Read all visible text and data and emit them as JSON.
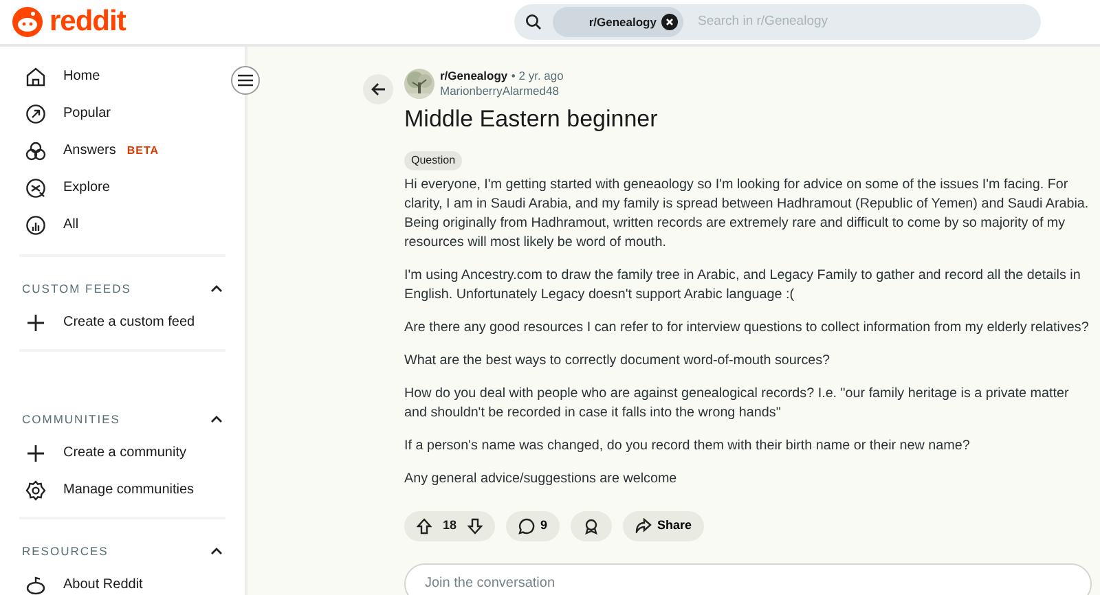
{
  "header": {
    "logo_text": "reddit",
    "search": {
      "chip": "r/Genealogy",
      "placeholder": "Search in r/Genealogy"
    }
  },
  "sidebar": {
    "items": [
      {
        "label": "Home",
        "kind": "home"
      },
      {
        "label": "Popular",
        "kind": "popular"
      },
      {
        "label": "Answers",
        "kind": "answers",
        "badge": "BETA"
      },
      {
        "label": "Explore",
        "kind": "explore"
      },
      {
        "label": "All",
        "kind": "all"
      }
    ],
    "sections": [
      {
        "title": "CUSTOM FEEDS",
        "expanded": true,
        "items": [
          {
            "label": "Create a custom feed",
            "kind": "plus"
          }
        ]
      },
      {
        "title": "COMMUNITIES",
        "expanded": true,
        "items": [
          {
            "label": "Create a community",
            "kind": "plus"
          },
          {
            "label": "Manage communities",
            "kind": "gear"
          }
        ]
      },
      {
        "title": "RESOURCES",
        "expanded": true,
        "items": [
          {
            "label": "About Reddit",
            "kind": "about"
          }
        ]
      }
    ]
  },
  "post": {
    "subreddit": "r/Genealogy",
    "separator": "•",
    "time": "2 yr. ago",
    "author": "MarionberryAlarmed48",
    "title": "Middle Eastern beginner",
    "flair": "Question",
    "paragraphs": [
      "Hi everyone, I'm getting started with geneaology so I'm looking for advice on some of the issues I'm facing. For clarity, I am in Saudi Arabia, and my family is spread between Hadhramout (Republic of Yemen) and Saudi Arabia. Being originally from Hadhramout, written records are extremely rare and difficult to come by so majority of my resources will most likely be word of mouth.",
      "I'm using Ancestry.com to draw the family tree in Arabic, and Legacy Family to gather and record all the details in English. Unfortunately Legacy doesn't support Arabic language :(",
      "Are there any good resources I can refer to for interview questions to collect information from my elderly relatives?",
      "What are the best ways to correctly document word-of-mouth sources?",
      "How do you deal with people who are against genealogical records? I.e. \"our family heritage is a private matter and shouldn't be recorded in case it falls into the wrong hands\"",
      "If a person's name was changed, do you record them with their birth name or their new name?",
      "Any general advice/suggestions are welcome"
    ],
    "votes": "18",
    "comments": "9",
    "share": "Share",
    "reply_placeholder": "Join the conversation"
  }
}
